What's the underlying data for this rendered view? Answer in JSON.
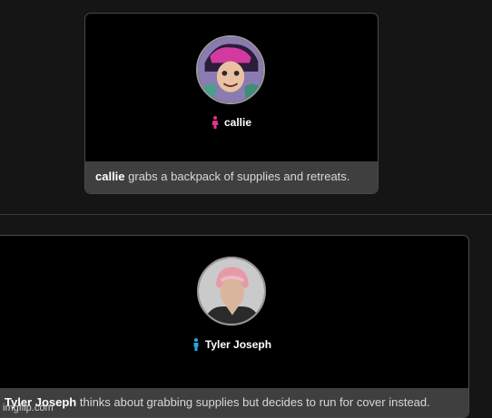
{
  "events": [
    {
      "actor": "callie",
      "gender_icon": "female-icon",
      "gender_color": "#e0358a",
      "action_text": " grabs a backpack of supplies and retreats."
    },
    {
      "actor": "Tyler Joseph",
      "gender_icon": "male-icon",
      "gender_color": "#2aa6dd",
      "action_text": " thinks about grabbing supplies but decides to run for cover instead."
    }
  ],
  "watermark": "imgflip.com",
  "colors": {
    "background": "#151515",
    "card": "#000000",
    "footer": "#3f3f3f"
  }
}
